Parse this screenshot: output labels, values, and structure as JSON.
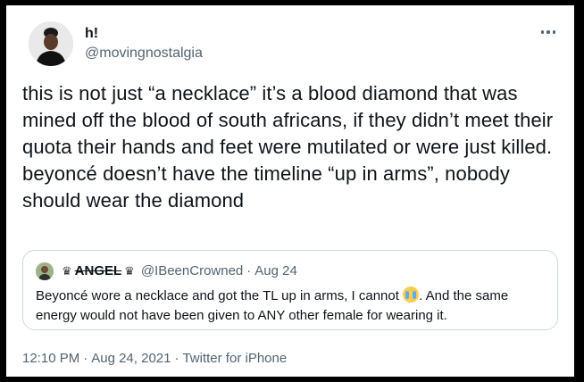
{
  "author": {
    "display_name": "h!",
    "handle": "@movingnostalgia",
    "avatar": "user-avatar"
  },
  "more_icon": "more-horizontal-icon",
  "tweet_text": "this is not just “a necklace” it’s a blood diamond that was mined off the blood of south africans, if they didn’t meet their quota their hands and feet were mutilated or were just killed. beyoncé doesn’t have the timeline “up in arms”, nobody should wear the diamond",
  "quote": {
    "crown_left": "♛",
    "display_name": "ANGEL",
    "crown_right": "♛",
    "handle": "@IBeenCrowned",
    "separator": "·",
    "date": "Aug 24",
    "text_before_emoji": "Beyoncé wore a necklace and got the TL up in arms, I cannot ",
    "emoji": "loudly-crying-face",
    "text_after_emoji": ". And the same energy would not have been given to ANY other female for wearing it."
  },
  "meta": {
    "time": "12:10 PM",
    "separator": "·",
    "date": "Aug 24, 2021",
    "source": "Twitter for iPhone"
  },
  "colors": {
    "text": "#0f1419",
    "secondary": "#536471",
    "border": "#cfd9de",
    "background": "#ffffff",
    "frame": "#000000"
  }
}
